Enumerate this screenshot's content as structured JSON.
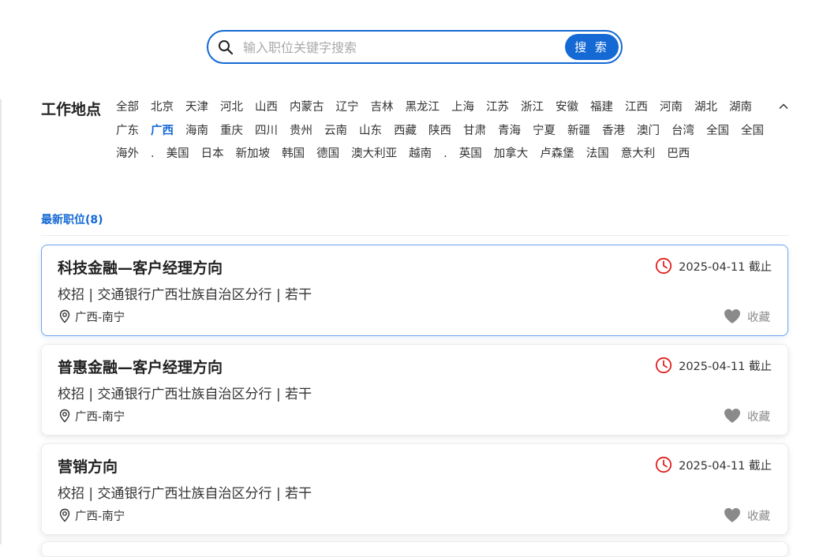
{
  "search": {
    "placeholder": "输入职位关键字搜索",
    "button_label": "搜 索"
  },
  "location_filter": {
    "title": "工作地点",
    "items": [
      "全部",
      "北京",
      "天津",
      "河北",
      "山西",
      "内蒙古",
      "辽宁",
      "吉林",
      "黑龙江",
      "上海",
      "江苏",
      "浙江",
      "安徽",
      "福建",
      "江西",
      "河南",
      "湖北",
      "湖南",
      "广东",
      "广西",
      "海南",
      "重庆",
      "四川",
      "贵州",
      "云南",
      "山东",
      "西藏",
      "陕西",
      "甘肃",
      "青海",
      "宁夏",
      "新疆",
      "香港",
      "澳门",
      "台湾",
      "全国",
      "全国",
      "海外",
      ".",
      "美国",
      "日本",
      "新加坡",
      "韩国",
      "德国",
      "澳大利亚",
      "越南",
      ".",
      "英国",
      "加拿大",
      "卢森堡",
      "法国",
      "意大利",
      "巴西"
    ],
    "active": "广西"
  },
  "latest": {
    "label": "最新职位(8)"
  },
  "jobs": [
    {
      "title": "科技金融—客户经理方向",
      "meta": "校招 | 交通银行广西壮族自治区分行 | 若干",
      "location": "广西-南宁",
      "deadline": "2025-04-11 截止",
      "fav_label": "收藏"
    },
    {
      "title": "普惠金融—客户经理方向",
      "meta": "校招 | 交通银行广西壮族自治区分行 | 若干",
      "location": "广西-南宁",
      "deadline": "2025-04-11 截止",
      "fav_label": "收藏"
    },
    {
      "title": "营销方向",
      "meta": "校招 | 交通银行广西壮族自治区分行 | 若干",
      "location": "广西-南宁",
      "deadline": "2025-04-11 截止",
      "fav_label": "收藏"
    }
  ],
  "colors": {
    "accent": "#1469d4",
    "deadline_icon": "#e02020",
    "fav_icon": "#8a8a8a"
  },
  "icons": {
    "search": "search-icon",
    "collapse": "chevron-up-icon",
    "location": "map-pin-icon",
    "deadline": "clock-icon",
    "favorite": "heart-icon"
  }
}
